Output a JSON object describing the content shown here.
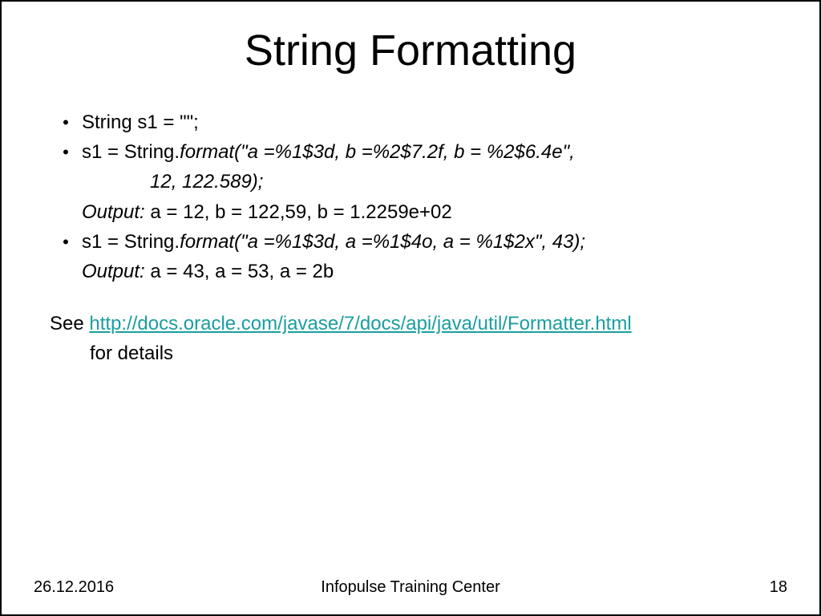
{
  "title": "String Formatting",
  "lines": {
    "l1": "String s1 = \"\";",
    "l2a": "s1 = String.",
    "l2b": "format(\"a =%1$3d, b =%2$7.2f, b = %2$6.4e\",",
    "l3": "12, 122.589);",
    "l4a": "Output:  ",
    "l4b": "a = 12, b = 122,59, b = 1.2259e+02",
    "l5a": "s1 = String.",
    "l5b": "format(\"a =%1$3d, a =%1$4o, a = %1$2x\", 43);",
    "l6a": "Output:  ",
    "l6b": "a = 43, a =  53, a = 2b"
  },
  "see": {
    "prefix": "See ",
    "link_text": "http://docs.oracle.com/javase/7/docs/api/java/util/Formatter.html",
    "suffix": "for details"
  },
  "footer": {
    "date": "26.12.2016",
    "center": "Infopulse Training Center",
    "page": "18"
  }
}
